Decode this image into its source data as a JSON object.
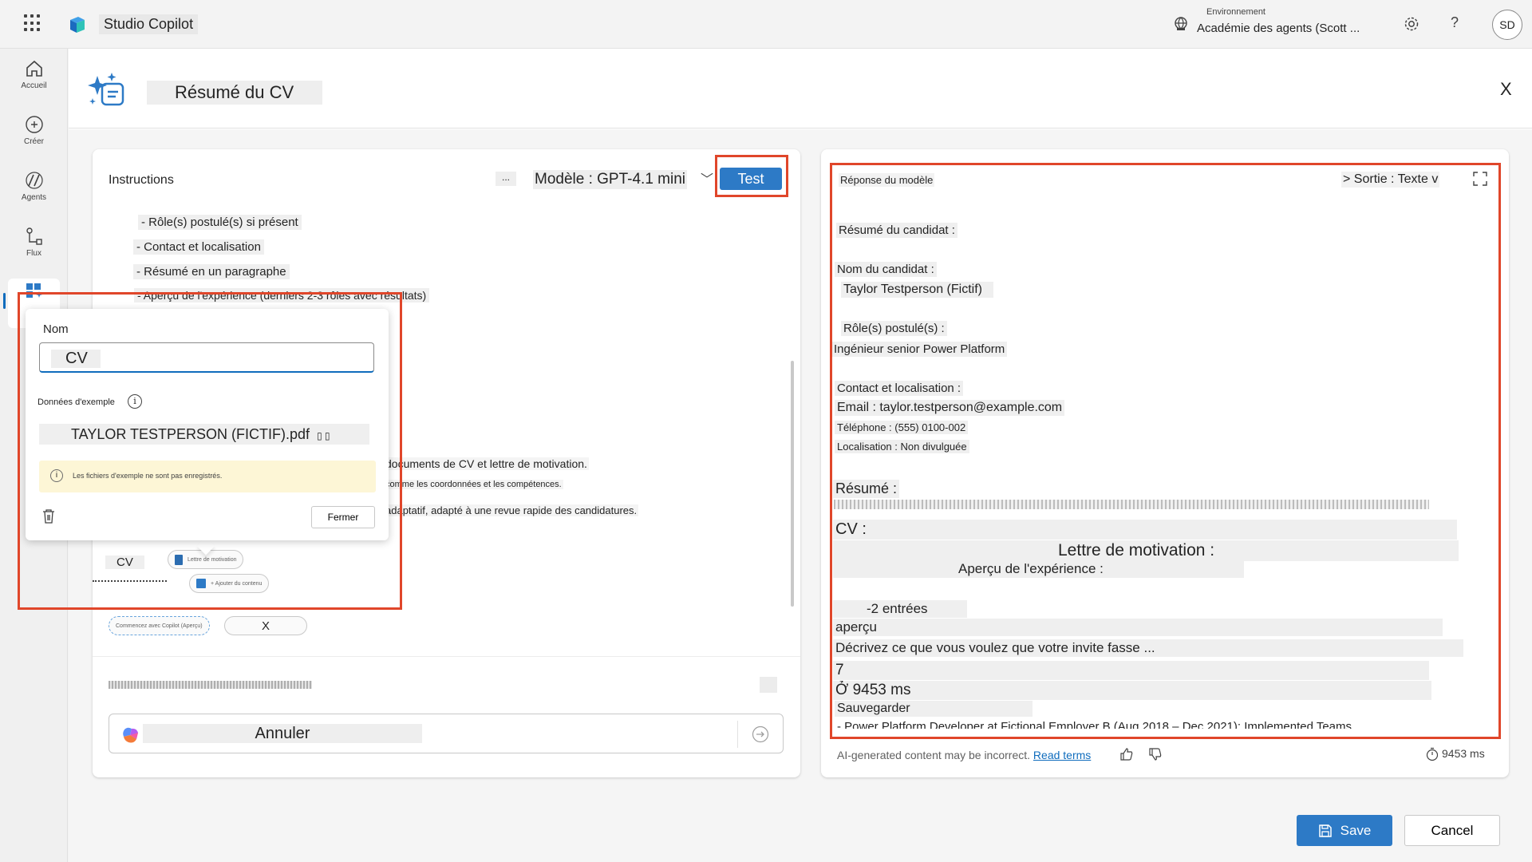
{
  "app": {
    "title": "Studio Copilot",
    "environment_label": "Environnement",
    "environment_name": "Académie des agents (Scott ...",
    "help": "?",
    "user_initials": "SD"
  },
  "nav": {
    "items": [
      {
        "label": "Accueil",
        "icon": "home-icon"
      },
      {
        "label": "Créer",
        "icon": "plus-circle-icon"
      },
      {
        "label": "Agents",
        "icon": "agents-icon"
      },
      {
        "label": "Flux",
        "icon": "flow-icon"
      },
      {
        "label": "",
        "icon": "tools-icon"
      }
    ]
  },
  "page": {
    "title": "Résumé du CV",
    "close": "X"
  },
  "instructions": {
    "title": "Instructions",
    "more": "...",
    "model": "Modèle : GPT-4.1 mini",
    "test_label": "Test",
    "lines": [
      "- Rôle(s) postulé(s) si présent",
      "- Contact et localisation",
      "- Résumé en un paragraphe",
      "- Aperçu de l'expérience (derniers 2-3 rôles avec résultats)"
    ],
    "mid_lines": [
      "documents de CV et lettre de motivation.",
      "comme les coordonnées et les compétences.",
      "adaptatif, adapté à une revue rapide des candidatures."
    ],
    "input_chip_name": "CV",
    "input_chip_cover": "Lettre de motivation",
    "add_content": "+ Ajouter du contenu",
    "copilot_chip": "Commencez avec Copilot (Aperçu)",
    "x_chip": "X",
    "prompt_value": "Annuler"
  },
  "popover": {
    "name_label": "Nom",
    "name_value": "CV",
    "sample_label": "Données d'exemple",
    "file_name": "TAYLOR TESTPERSON (FICTIF).pdf",
    "warning": "Les fichiers d'exemple ne sont pas enregistrés.",
    "close_label": "Fermer"
  },
  "response": {
    "title": "Réponse du modèle",
    "output": "> Sortie : Texte v",
    "lines": [
      "Résumé du candidat :",
      "Nom du candidat :",
      "Taylor Testperson (Fictif)",
      "Rôle(s) postulé(s) :",
      "Ingénieur senior Power Platform",
      "Contact et localisation :",
      "Email : taylor.testperson@example.com",
      "Téléphone : (555) 0100-002",
      "Localisation : Non divulguée",
      "Résumé :",
      "CV :",
      "Lettre de motivation :",
      "Aperçu de l'expérience :",
      "-2 entrées",
      "aperçu",
      "Décrivez ce que vous voulez que votre invite fasse ...",
      "7",
      "Ở 9453 ms",
      "Sauvegarder",
      "- Power Platform Developer at Fictional Employer B (Aug 2018 – Dec 2021): Implemented Teams"
    ],
    "ai_note": "AI-generated content may be incorrect.",
    "read_terms": "Read terms",
    "duration": "9453 ms"
  },
  "footer": {
    "save": "Save",
    "cancel": "Cancel"
  },
  "colors": {
    "accent": "#2d7ac6",
    "highlight": "#e0462a",
    "warning_bg": "#fdf6d6"
  }
}
